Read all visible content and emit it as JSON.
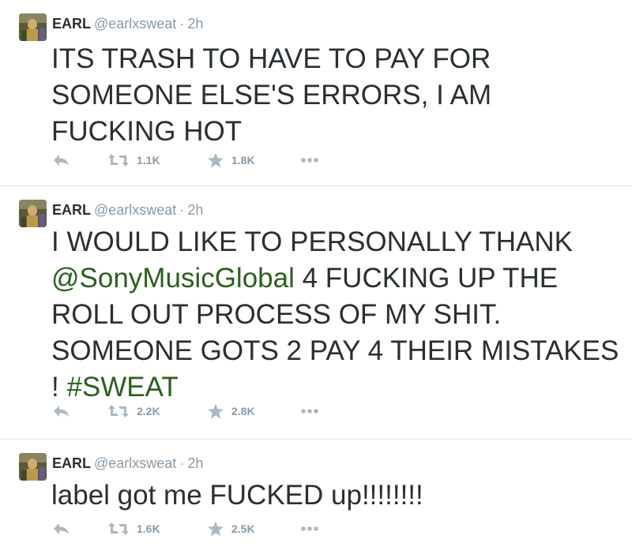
{
  "tweets": [
    {
      "name": "EARL",
      "handle": "@earlxsweat",
      "separator": "·",
      "time": "2h",
      "text_parts": {
        "before": "ITS TRASH TO HAVE TO PAY FOR SOMEONE ELSE'S ERRORS, I AM FUCKING HOT"
      },
      "retweets": "1.1K",
      "favorites": "1.8K"
    },
    {
      "name": "EARL",
      "handle": "@earlxsweat",
      "separator": "·",
      "time": "2h",
      "text_parts": {
        "line1": "I WOULD LIKE TO PERSONALLY THANK",
        "mention": "@SonyMusicGlobal",
        "line2": " 4 FUCKING UP THE ROLL OUT PROCESS OF MY SHIT. SOMEONE GOTS 2 PAY 4 THEIR MISTAKES ! ",
        "hashtag": "#SWEAT"
      },
      "retweets": "2.2K",
      "favorites": "2.8K"
    },
    {
      "name": "EARL",
      "handle": "@earlxsweat",
      "separator": "·",
      "time": "2h",
      "text_parts": {
        "before": "label got me FUCKED up!!!!!!!!"
      },
      "retweets": "1.6K",
      "favorites": "2.5K"
    }
  ],
  "icons": {
    "reply": "reply-icon",
    "retweet": "retweet-icon",
    "favorite": "star-icon",
    "more": "more-icon"
  },
  "colors": {
    "link": "#2b5f1f",
    "meta": "#8899a6",
    "icon": "#aab8c2",
    "text": "#292f33"
  }
}
